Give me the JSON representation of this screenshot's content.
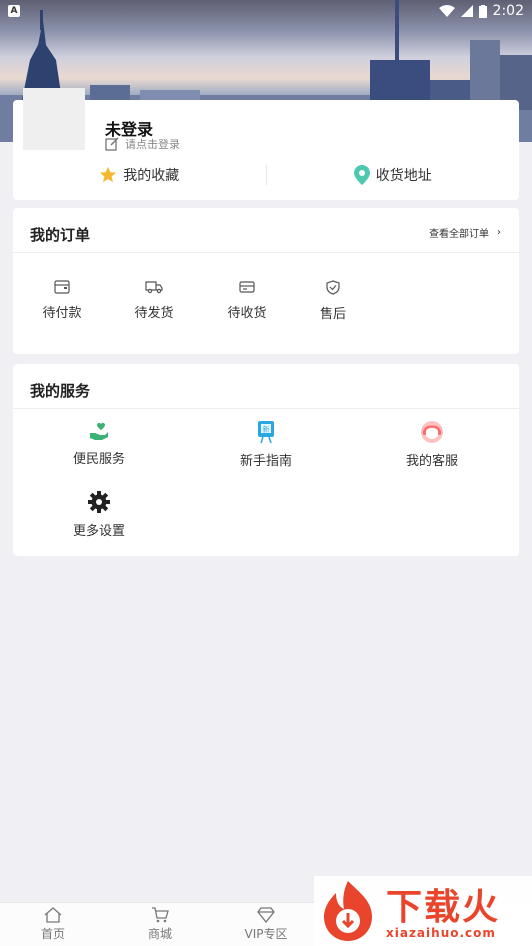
{
  "status_bar": {
    "time": "2:02"
  },
  "profile": {
    "username": "未登录",
    "login_hint": "请点击登录",
    "quick_links": [
      {
        "label": "我的收藏",
        "icon": "star-icon",
        "color": "#f5b82e"
      },
      {
        "label": "收货地址",
        "icon": "location-pin-icon",
        "color": "#4ec9b0"
      }
    ]
  },
  "orders": {
    "title": "我的订单",
    "view_all": "查看全部订单",
    "items": [
      {
        "label": "待付款",
        "icon": "wallet-icon"
      },
      {
        "label": "待发货",
        "icon": "truck-icon"
      },
      {
        "label": "待收货",
        "icon": "card-icon"
      },
      {
        "label": "售后",
        "icon": "shield-icon"
      }
    ]
  },
  "services": {
    "title": "我的服务",
    "items": [
      {
        "label": "便民服务",
        "icon": "hand-heart-icon",
        "color": "#3bb273"
      },
      {
        "label": "新手指南",
        "icon": "guide-board-icon",
        "color": "#2ba7e0"
      },
      {
        "label": "我的客服",
        "icon": "customer-service-icon",
        "color": "#ff7a7a"
      },
      {
        "label": "更多设置",
        "icon": "gear-icon",
        "color": "#222222"
      }
    ]
  },
  "tabbar": {
    "tabs": [
      {
        "label": "首页",
        "icon": "home-icon"
      },
      {
        "label": "商城",
        "icon": "cart-icon"
      },
      {
        "label": "VIP专区",
        "icon": "diamond-icon"
      }
    ]
  },
  "watermark": {
    "title": "下载火",
    "url": "xiazaihuo.com"
  }
}
